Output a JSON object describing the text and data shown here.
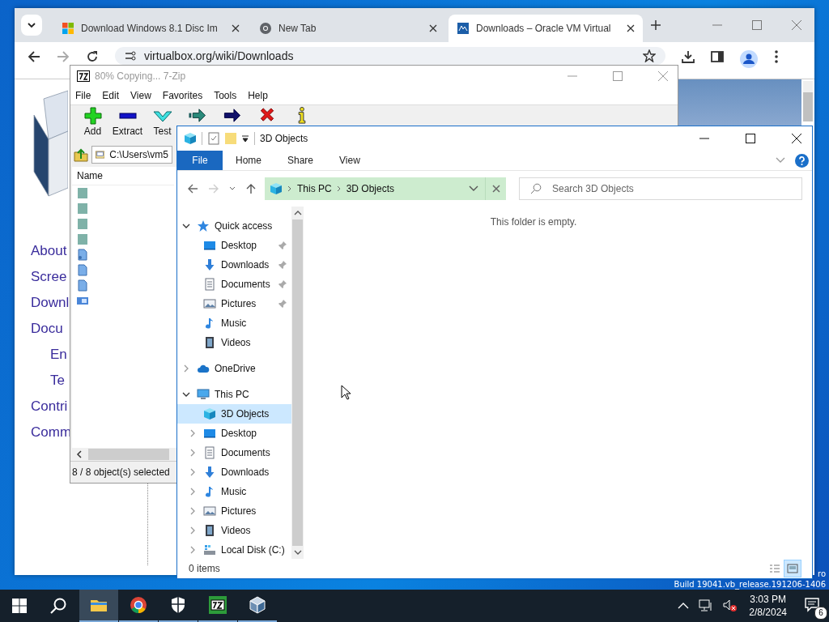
{
  "browser": {
    "tabs": [
      {
        "title": "Download Windows 8.1 Disc Im",
        "kind": "windows",
        "selected": false
      },
      {
        "title": "New Tab",
        "kind": "chrome",
        "selected": false
      },
      {
        "title": "Downloads – Oracle VM Virtual",
        "kind": "vbox",
        "selected": true
      }
    ],
    "url": "virtualbox.org/wiki/Downloads",
    "links": [
      {
        "label": "About",
        "kind": "main"
      },
      {
        "label": "Scree",
        "kind": "main"
      },
      {
        "label": "Downl",
        "kind": "main"
      },
      {
        "label": "Docu",
        "kind": "main"
      },
      {
        "label": "En",
        "kind": "sub"
      },
      {
        "label": "Te",
        "kind": "sub"
      },
      {
        "label": "Contri",
        "kind": "main"
      },
      {
        "label": "Comm",
        "kind": "main"
      }
    ]
  },
  "sevenzip": {
    "title": "80% Copying... 7-Zip",
    "menu": [
      "File",
      "Edit",
      "View",
      "Favorites",
      "Tools",
      "Help"
    ],
    "toolbar": [
      {
        "label": "Add",
        "kind": "add"
      },
      {
        "label": "Extract",
        "kind": "extract"
      },
      {
        "label": "Test",
        "kind": "test"
      },
      {
        "kind": "copy"
      },
      {
        "kind": "move"
      },
      {
        "kind": "delete"
      },
      {
        "kind": "info"
      }
    ],
    "path": "C:\\Users\\vm5",
    "column": "Name",
    "files": [
      {
        "kind": "folder"
      },
      {
        "kind": "folder"
      },
      {
        "kind": "folder"
      },
      {
        "kind": "folder"
      },
      {
        "kind": "script"
      },
      {
        "kind": "file"
      },
      {
        "kind": "file"
      },
      {
        "kind": "window"
      }
    ],
    "status": "8 / 8 object(s) selected"
  },
  "explorer": {
    "title": "3D Objects",
    "ribbon_tabs": [
      {
        "label": "File",
        "kind": "file"
      },
      {
        "label": "Home",
        "kind": "tab"
      },
      {
        "label": "Share",
        "kind": "tab"
      },
      {
        "label": "View",
        "kind": "tab"
      }
    ],
    "breadcrumbs": [
      "This PC",
      "3D Objects"
    ],
    "search": {
      "placeholder": "Search 3D Objects"
    },
    "tree": [
      {
        "label": "Quick access",
        "kind": "star",
        "expanded": true,
        "selected": false,
        "children": [
          {
            "label": "Desktop",
            "kind": "desktop",
            "pinned": true,
            "selected": false
          },
          {
            "label": "Downloads",
            "kind": "download",
            "pinned": true,
            "selected": false
          },
          {
            "label": "Documents",
            "kind": "document",
            "pinned": true,
            "selected": false
          },
          {
            "label": "Pictures",
            "kind": "pictures",
            "pinned": true,
            "selected": false
          },
          {
            "label": "Music",
            "kind": "music",
            "pinned": false,
            "selected": false
          },
          {
            "label": "Videos",
            "kind": "videos",
            "pinned": false,
            "selected": false
          }
        ]
      },
      {
        "label": "OneDrive",
        "kind": "cloud",
        "expanded": false,
        "selected": false
      },
      {
        "label": "This PC",
        "kind": "pc",
        "expanded": true,
        "selected": false,
        "children": [
          {
            "label": "3D Objects",
            "kind": "cube",
            "selected": true
          },
          {
            "label": "Desktop",
            "kind": "desktop",
            "expanded": false,
            "selected": false
          },
          {
            "label": "Documents",
            "kind": "document",
            "expanded": false,
            "selected": false
          },
          {
            "label": "Downloads",
            "kind": "download",
            "expanded": false,
            "selected": false
          },
          {
            "label": "Music",
            "kind": "music",
            "expanded": false,
            "selected": false
          },
          {
            "label": "Pictures",
            "kind": "pictures",
            "expanded": false,
            "selected": false
          },
          {
            "label": "Videos",
            "kind": "videos",
            "expanded": false,
            "selected": false
          },
          {
            "label": "Local Disk (C:)",
            "kind": "disk",
            "expanded": false,
            "selected": false
          }
        ]
      }
    ],
    "empty_message": "This folder is empty.",
    "status": "0 items",
    "views": [
      {
        "kind": "details",
        "selected": false
      },
      {
        "kind": "large",
        "selected": true
      }
    ]
  },
  "desktop": {
    "watermark": [
      "ro",
      "Build 19041.vb_release.191206-1406"
    ]
  },
  "taskbar": {
    "apps": [
      {
        "kind": "explorer",
        "active": true
      },
      {
        "kind": "chrome",
        "active": false
      },
      {
        "kind": "shield",
        "active": false
      },
      {
        "kind": "sevenzip",
        "active": false
      },
      {
        "kind": "vbox",
        "active": false
      }
    ],
    "time": "3:03 PM",
    "date": "2/8/2024",
    "notifications": "6"
  }
}
